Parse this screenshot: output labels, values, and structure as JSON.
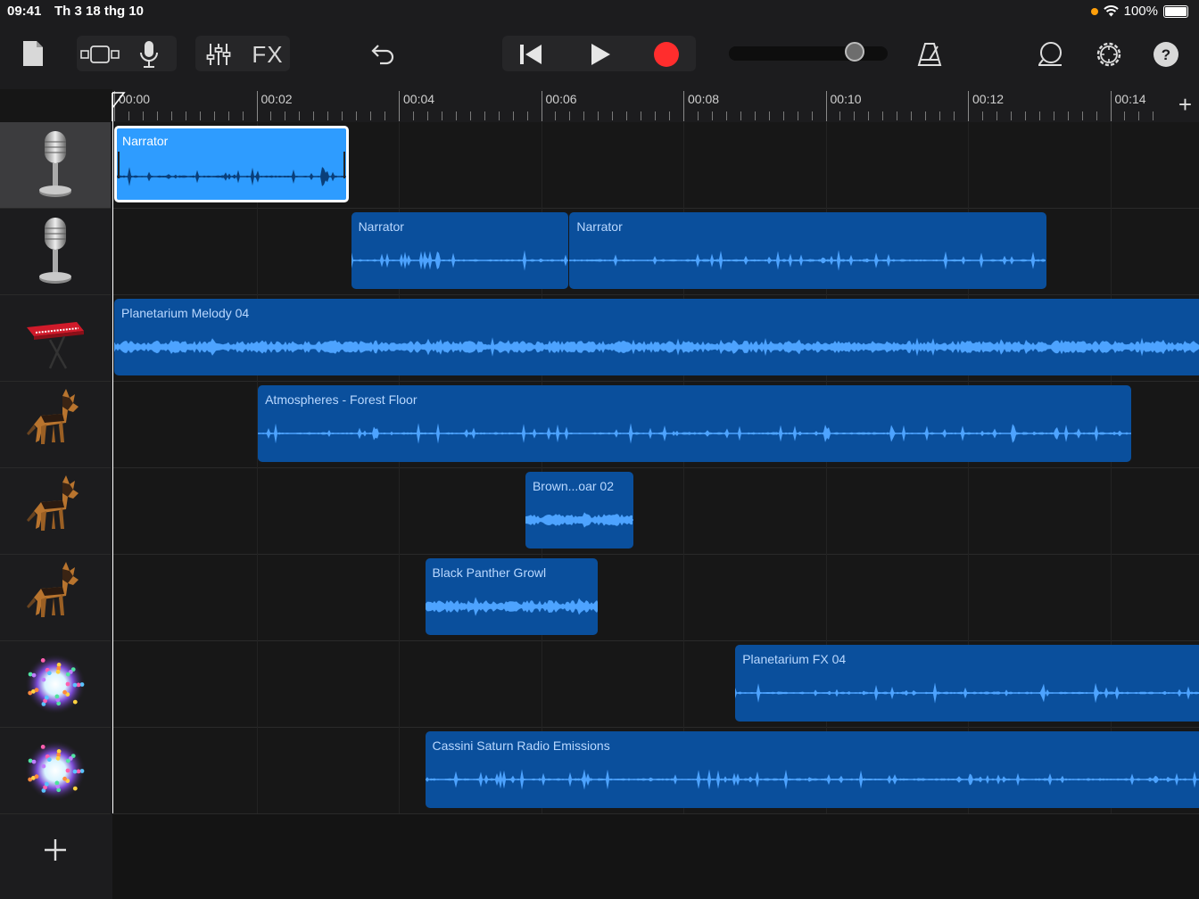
{
  "status": {
    "time": "09:41",
    "date": "Th 3 18 thg 10",
    "battery": "100%"
  },
  "toolbar": {
    "fx_label": "FX",
    "icons": [
      "file-icon",
      "view-toggle-icon",
      "microphone-icon",
      "mixer-icon",
      "fx-button",
      "undo-icon",
      "rewind-icon",
      "play-icon",
      "record-icon",
      "volume-slider",
      "metronome-icon",
      "loop-icon",
      "settings-icon",
      "help-icon"
    ],
    "record_color": "#ff2d2d",
    "volume_level": 0.79
  },
  "ruler": {
    "labels": [
      "00:00",
      "00:02",
      "00:04",
      "00:06",
      "00:08",
      "00:10",
      "00:12",
      "00:14"
    ]
  },
  "tracks": [
    {
      "icon": "microphone-icon",
      "selected": true
    },
    {
      "icon": "microphone-icon",
      "selected": false
    },
    {
      "icon": "keyboard-icon",
      "selected": false
    },
    {
      "icon": "dog-icon",
      "selected": false
    },
    {
      "icon": "dog-icon",
      "selected": false
    },
    {
      "icon": "dog-icon",
      "selected": false
    },
    {
      "icon": "sparkle-icon",
      "selected": false
    },
    {
      "icon": "sparkle-icon",
      "selected": false
    }
  ],
  "regions": [
    {
      "track": 0,
      "name": "Narrator",
      "start_s": 0.0,
      "end_s": 3.3,
      "selected": true
    },
    {
      "track": 1,
      "name": "Narrator",
      "start_s": 3.33,
      "end_s": 6.38
    },
    {
      "track": 1,
      "name": "Narrator",
      "start_s": 6.4,
      "end_s": 13.1
    },
    {
      "track": 2,
      "name": "Planetarium Melody 04",
      "start_s": 0.0,
      "end_s": 15.3
    },
    {
      "track": 3,
      "name": "Atmospheres - Forest Floor",
      "start_s": 2.02,
      "end_s": 14.3
    },
    {
      "track": 4,
      "name": "Brown...oar 02",
      "start_s": 5.78,
      "end_s": 7.3
    },
    {
      "track": 5,
      "name": "Black Panther Growl",
      "start_s": 4.37,
      "end_s": 6.8
    },
    {
      "track": 6,
      "name": "Planetarium FX 04",
      "start_s": 8.73,
      "end_s": 15.3
    },
    {
      "track": 7,
      "name": "Cassini Saturn Radio Emissions",
      "start_s": 4.37,
      "end_s": 15.3
    }
  ],
  "colors": {
    "region": "#0a4f9c",
    "region_selected": "#2e9cff",
    "waveform": "#4da3ff"
  }
}
